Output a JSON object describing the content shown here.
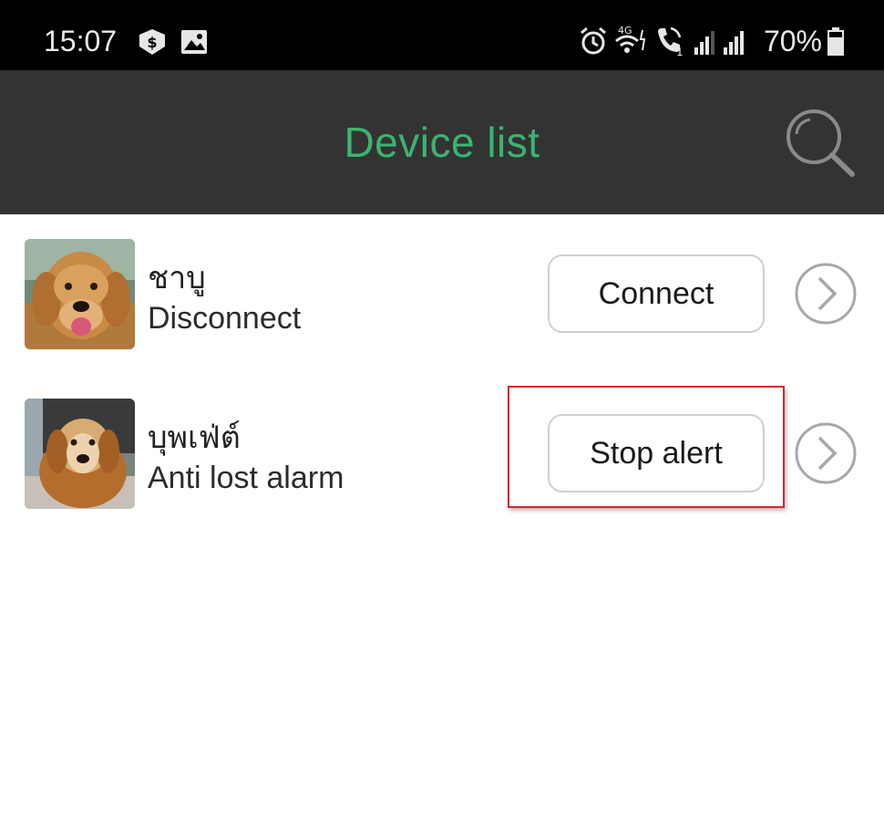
{
  "status_bar": {
    "time": "15:07",
    "network_label": "4G",
    "sim_label": "1",
    "battery_text": "70%",
    "icons": [
      "cash-app-icon",
      "gallery-icon",
      "alarm-icon",
      "wifi-4g-icon",
      "volte-call-icon",
      "signal-icon",
      "signal-icon",
      "battery-icon"
    ]
  },
  "header": {
    "title": "Device list",
    "search_icon": "search-icon"
  },
  "devices": [
    {
      "name": "ชาบู",
      "status": "Disconnect",
      "action_label": "Connect",
      "avatar": "dog-photo",
      "chevron_icon": "chevron-right-icon"
    },
    {
      "name": "บุพเฟ่ต์",
      "status": "Anti lost alarm",
      "action_label": "Stop alert",
      "avatar": "dog-photo",
      "chevron_icon": "chevron-right-icon"
    }
  ],
  "colors": {
    "status_bar_bg": "#000000",
    "header_bg": "#333333",
    "title_color": "#3cb371",
    "highlight": "#d22b2b"
  }
}
